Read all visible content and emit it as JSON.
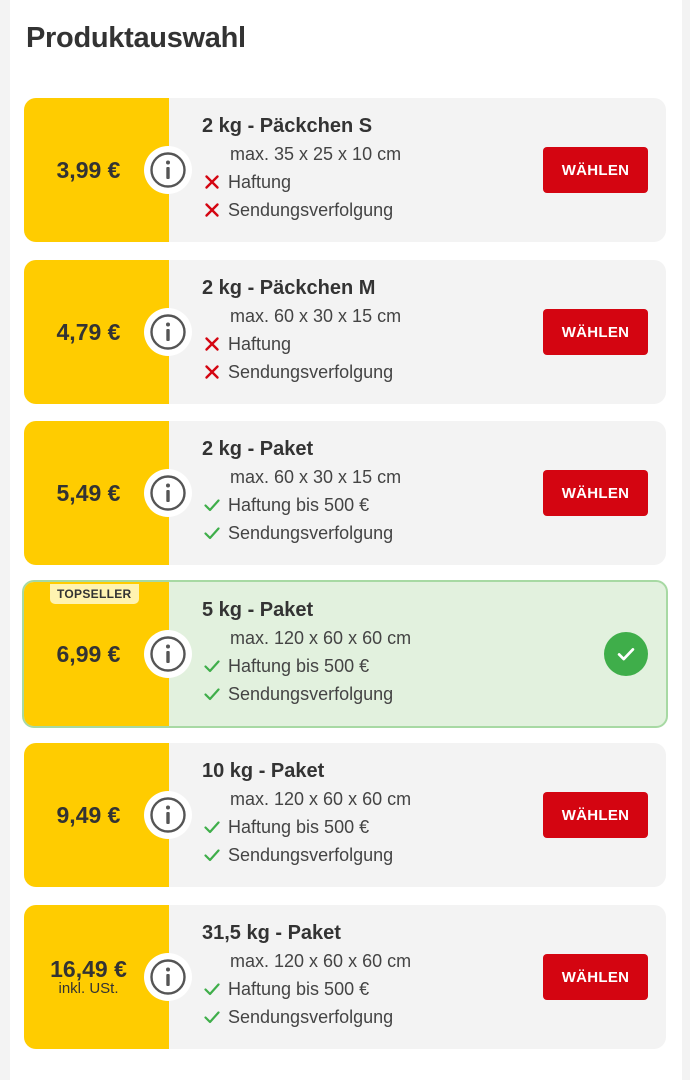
{
  "page_title": "Produktauswahl",
  "choose_label": "WÄHLEN",
  "colors": {
    "price_bg": "#ffcc00",
    "button": "#d40511",
    "check_green": "#3fae4a",
    "cross_red": "#d40511",
    "selected_bg": "#e2f1de"
  },
  "products": [
    {
      "price": "3,99 €",
      "price_note": "",
      "name": "2 kg - Päckchen S",
      "dimensions": "max. 35 x 25 x 10 cm",
      "features": [
        {
          "icon": "cross-icon",
          "text": "Haftung"
        },
        {
          "icon": "cross-icon",
          "text": "Sendungsverfolgung"
        }
      ],
      "selected": false,
      "badge": ""
    },
    {
      "price": "4,79 €",
      "price_note": "",
      "name": "2 kg - Päckchen M",
      "dimensions": "max. 60 x 30 x 15 cm",
      "features": [
        {
          "icon": "cross-icon",
          "text": "Haftung"
        },
        {
          "icon": "cross-icon",
          "text": "Sendungsverfolgung"
        }
      ],
      "selected": false,
      "badge": ""
    },
    {
      "price": "5,49 €",
      "price_note": "",
      "name": "2 kg - Paket",
      "dimensions": "max. 60 x 30 x 15 cm",
      "features": [
        {
          "icon": "check-icon",
          "text": "Haftung bis 500 €"
        },
        {
          "icon": "check-icon",
          "text": "Sendungsverfolgung"
        }
      ],
      "selected": false,
      "badge": ""
    },
    {
      "price": "6,99 €",
      "price_note": "",
      "name": "5 kg - Paket",
      "dimensions": "max. 120 x 60 x 60 cm",
      "features": [
        {
          "icon": "check-icon",
          "text": "Haftung bis 500 €"
        },
        {
          "icon": "check-icon",
          "text": "Sendungsverfolgung"
        }
      ],
      "selected": true,
      "badge": "TOPSELLER"
    },
    {
      "price": "9,49 €",
      "price_note": "",
      "name": "10 kg - Paket",
      "dimensions": "max. 120 x 60 x 60 cm",
      "features": [
        {
          "icon": "check-icon",
          "text": "Haftung bis 500 €"
        },
        {
          "icon": "check-icon",
          "text": "Sendungsverfolgung"
        }
      ],
      "selected": false,
      "badge": ""
    },
    {
      "price": "16,49 €",
      "price_note": "inkl. USt.",
      "name": "31,5 kg - Paket",
      "dimensions": "max. 120 x 60 x 60 cm",
      "features": [
        {
          "icon": "check-icon",
          "text": "Haftung bis 500 €"
        },
        {
          "icon": "check-icon",
          "text": "Sendungsverfolgung"
        }
      ],
      "selected": false,
      "badge": ""
    }
  ]
}
